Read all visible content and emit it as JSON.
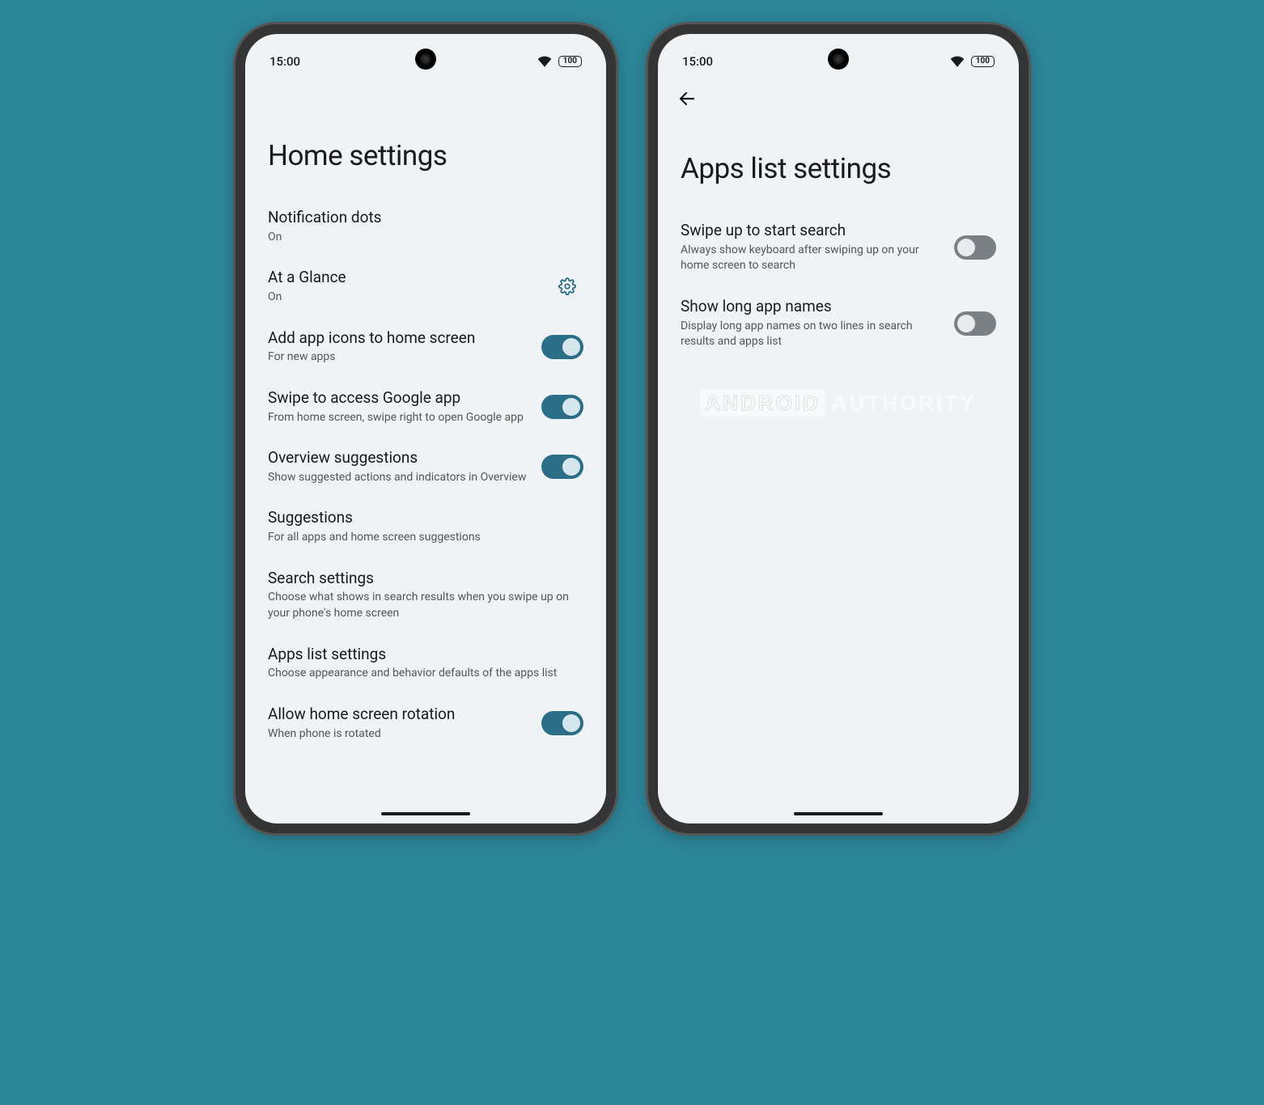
{
  "status_bar": {
    "time": "15:00",
    "battery": "100"
  },
  "left_phone": {
    "title": "Home settings",
    "items": [
      {
        "title": "Notification dots",
        "subtitle": "On",
        "control": "none"
      },
      {
        "title": "At a Glance",
        "subtitle": "On",
        "control": "gear"
      },
      {
        "title": "Add app icons to home screen",
        "subtitle": "For new apps",
        "control": "toggle",
        "on": true
      },
      {
        "title": "Swipe to access Google app",
        "subtitle": "From home screen, swipe right to open Google app",
        "control": "toggle",
        "on": true
      },
      {
        "title": "Overview suggestions",
        "subtitle": "Show suggested actions and indicators in Overview",
        "control": "toggle",
        "on": true
      },
      {
        "title": "Suggestions",
        "subtitle": "For all apps and home screen suggestions",
        "control": "none"
      },
      {
        "title": "Search settings",
        "subtitle": "Choose what shows in search results when you swipe up on your phone's home screen",
        "control": "none"
      },
      {
        "title": "Apps list settings",
        "subtitle": "Choose appearance and behavior defaults of the apps list",
        "control": "none"
      },
      {
        "title": "Allow home screen rotation",
        "subtitle": "When phone is rotated",
        "control": "toggle",
        "on": true
      }
    ]
  },
  "right_phone": {
    "title": "Apps list settings",
    "has_back": true,
    "items": [
      {
        "title": "Swipe up to start search",
        "subtitle": "Always show keyboard after swiping up on your home screen to search",
        "control": "toggle",
        "on": false
      },
      {
        "title": "Show long app names",
        "subtitle": "Display long app names on two lines in search results and apps list",
        "control": "toggle",
        "on": false
      }
    ]
  },
  "watermark": {
    "part1": "ANDROID",
    "part2": "AUTHORITY"
  }
}
